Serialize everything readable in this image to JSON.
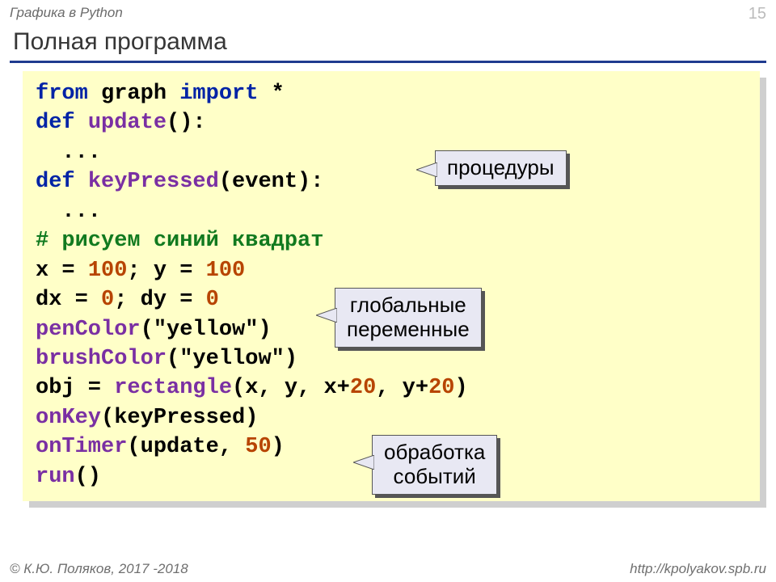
{
  "header": {
    "category": "Графика в Python",
    "page": "15"
  },
  "title": "Полная программа",
  "code": {
    "l1_from": "from",
    "l1_mod": "graph",
    "l1_import": "import",
    "l1_star": "*",
    "l2_def": "def",
    "l2_name": "update",
    "l2_tail": "():",
    "l3": "  ...",
    "l4_def": "def",
    "l4_name": "keyPressed",
    "l4_tail": "(event):",
    "l5": "  ...",
    "l6_comment": "# рисуем синий квадрат",
    "l7_a": "x = ",
    "l7_n1": "100",
    "l7_b": "; y = ",
    "l7_n2": "100",
    "l8_a": "dx = ",
    "l8_n1": "0",
    "l8_b": "; dy = ",
    "l8_n2": "0",
    "l9_fn": "penColor",
    "l9_arg": "(\"yellow\")",
    "l10_fn": "brushColor",
    "l10_arg": "(\"yellow\")",
    "l11_a": "obj = ",
    "l11_fn": "rectangle",
    "l11_b": "(x, y, x+",
    "l11_n1": "20",
    "l11_c": ", y+",
    "l11_n2": "20",
    "l11_d": ")",
    "l12_fn": "onKey",
    "l12_arg": "(keyPressed)",
    "l13_fn": "onTimer",
    "l13_a": "(update, ",
    "l13_n": "50",
    "l13_b": ")",
    "l14_fn": "run",
    "l14_arg": "()"
  },
  "callouts": {
    "procedures": "процедуры",
    "globals_l1": "глобальные",
    "globals_l2": "переменные",
    "events_l1": "обработка",
    "events_l2": "событий"
  },
  "footer": {
    "left": "© К.Ю. Поляков, 2017 -2018",
    "right": "http://kpolyakov.spb.ru"
  }
}
